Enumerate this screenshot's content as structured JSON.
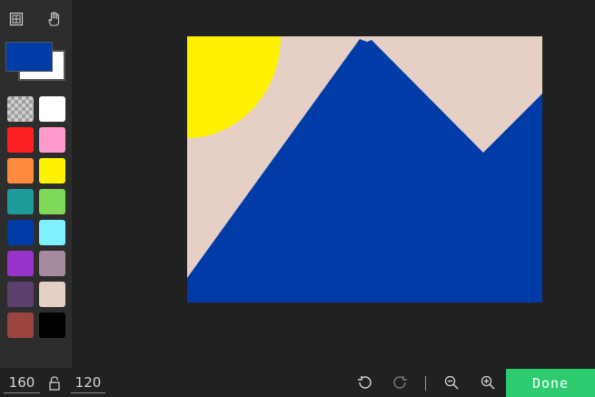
{
  "toolbar": {
    "tools": [
      {
        "name": "grid-icon"
      },
      {
        "name": "hand-icon"
      }
    ],
    "primary_color": "#003ca8",
    "secondary_color": "#ffffff"
  },
  "palette": [
    {
      "name": "transparent",
      "color": "transparent"
    },
    {
      "name": "white",
      "color": "#ffffff"
    },
    {
      "name": "red",
      "color": "#ff2121"
    },
    {
      "name": "pink",
      "color": "#ff99cc"
    },
    {
      "name": "orange",
      "color": "#ff8a3d"
    },
    {
      "name": "yellow",
      "color": "#fff200"
    },
    {
      "name": "teal",
      "color": "#1f9a9a"
    },
    {
      "name": "green",
      "color": "#7ed957"
    },
    {
      "name": "blue",
      "color": "#003ca8"
    },
    {
      "name": "light-blue",
      "color": "#7ff0ff"
    },
    {
      "name": "purple",
      "color": "#9933cc"
    },
    {
      "name": "mauve",
      "color": "#a68a9e"
    },
    {
      "name": "dark-purple",
      "color": "#5c3f6e"
    },
    {
      "name": "beige",
      "color": "#e6cfc4"
    },
    {
      "name": "brown",
      "color": "#9c4440"
    },
    {
      "name": "black",
      "color": "#000000"
    }
  ],
  "canvas": {
    "background": "#e6cfc4",
    "sun_color": "#fff200",
    "mountain_color": "#003ca8"
  },
  "bottom_bar": {
    "width_value": "160",
    "height_value": "120",
    "done_label": "Done",
    "accent_color": "#2ecc71"
  }
}
